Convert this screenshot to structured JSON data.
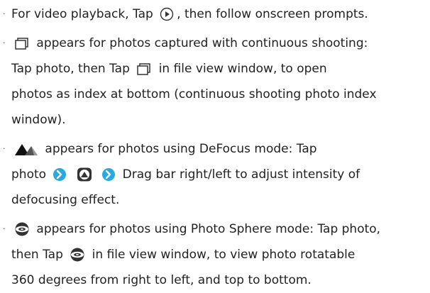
{
  "bullets": [
    {
      "lines": [
        [
          "For video playback, Tap ",
          "icon:play-icon",
          ", then follow onscreen prompts."
        ]
      ]
    },
    {
      "lines": [
        [
          "icon:continuous-shooting-icon",
          " appears for photos captured with continuous shooting:"
        ],
        [
          "Tap photo, then Tap ",
          "icon:continuous-shooting-icon",
          " in file view window, to open"
        ],
        [
          "photos as index at bottom (continuous shooting photo index"
        ],
        [
          "window)."
        ]
      ]
    },
    {
      "lines": [
        [
          "icon:defocus-icon",
          " appears for photos using DeFocus mode: Tap"
        ],
        [
          "photo ",
          "icon:arrow-right-icon",
          " ",
          "icon:defocus-mode-icon",
          " ",
          "icon:arrow-right-icon",
          " Drag bar right/left to adjust intensity of"
        ],
        [
          "defocusing effect."
        ]
      ]
    },
    {
      "lines": [
        [
          "icon:photo-sphere-icon",
          " appears for photos using Photo Sphere mode: Tap photo,"
        ],
        [
          "then Tap ",
          "icon:photo-sphere-icon",
          " in file view window, to view photo rotatable"
        ],
        [
          "360 degrees from right to left, and top to bottom."
        ]
      ]
    }
  ],
  "colors": {
    "text": "#222222",
    "arrow": "#29a9e1"
  }
}
